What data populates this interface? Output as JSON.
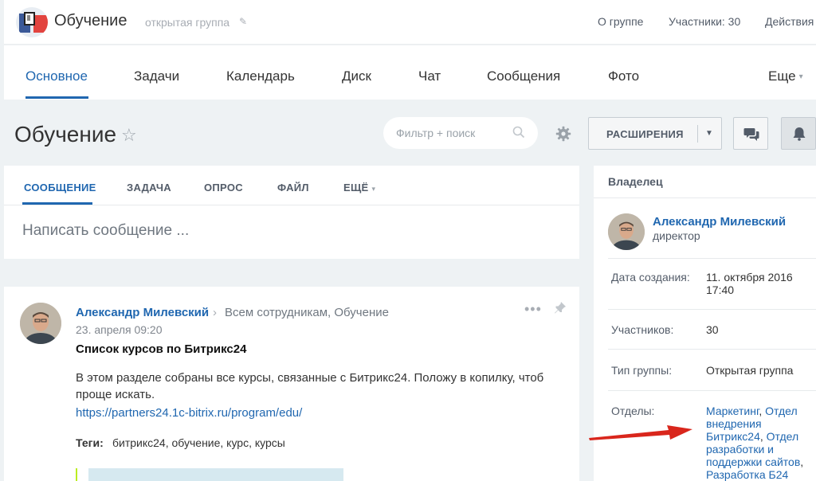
{
  "header": {
    "group_title": "Обучение",
    "group_type": "открытая группа",
    "links": [
      "О группе",
      "Участники: 30",
      "Действия"
    ]
  },
  "nav": {
    "tabs": [
      "Основное",
      "Задачи",
      "Календарь",
      "Диск",
      "Чат",
      "Сообщения",
      "Фото"
    ],
    "more": "Еще",
    "active": "Основное"
  },
  "page": {
    "title": "Обучение",
    "search_placeholder": "Фильтр + поиск",
    "extensions_label": "РАСШИРЕНИЯ"
  },
  "composer": {
    "tabs": [
      "СООБЩЕНИЕ",
      "ЗАДАЧА",
      "ОПРОС",
      "ФАЙЛ",
      "ЕЩЁ"
    ],
    "placeholder": "Написать сообщение ..."
  },
  "post": {
    "author": "Александр Милевский",
    "destination": "Всем сотрудникам, Обучение",
    "date": "23. апреля 09:20",
    "title": "Список курсов по Битрикс24",
    "body": "В этом разделе собраны все курсы, связанные с Битрикс24. Положу в копилку, чтоб проще искать.",
    "link": "https://partners24.1c-bitrix.ru/program/edu/",
    "tags_label": "Теги:",
    "tags": "битрикс24, обучение, курс, курсы"
  },
  "sidebar": {
    "owner_heading": "Владелец",
    "owner_name": "Александр Милевский",
    "owner_position": "директор",
    "created_label": "Дата создания:",
    "created_value": "11. октября 2016 17:40",
    "members_label": "Участников:",
    "members_value": "30",
    "type_label": "Тип группы:",
    "type_value": "Открытая группа",
    "departments_label": "Отделы:",
    "departments": [
      "Маркетинг",
      "Отдел внедрения Битрикс24",
      "Отдел разработки и поддержки сайтов",
      "Разработка Б24"
    ]
  },
  "colors": {
    "accent": "#2067b0",
    "background": "#eef2f4",
    "annotation_arrow": "#d9261c"
  },
  "icons": {
    "logo": "group-logo-icon",
    "edit": "pencil-icon",
    "favorite": "star-icon",
    "search": "search-icon",
    "settings": "gear-icon",
    "chat": "chat-icon",
    "notifications": "bell-icon",
    "more": "more-dots-icon",
    "pin": "pin-icon"
  }
}
